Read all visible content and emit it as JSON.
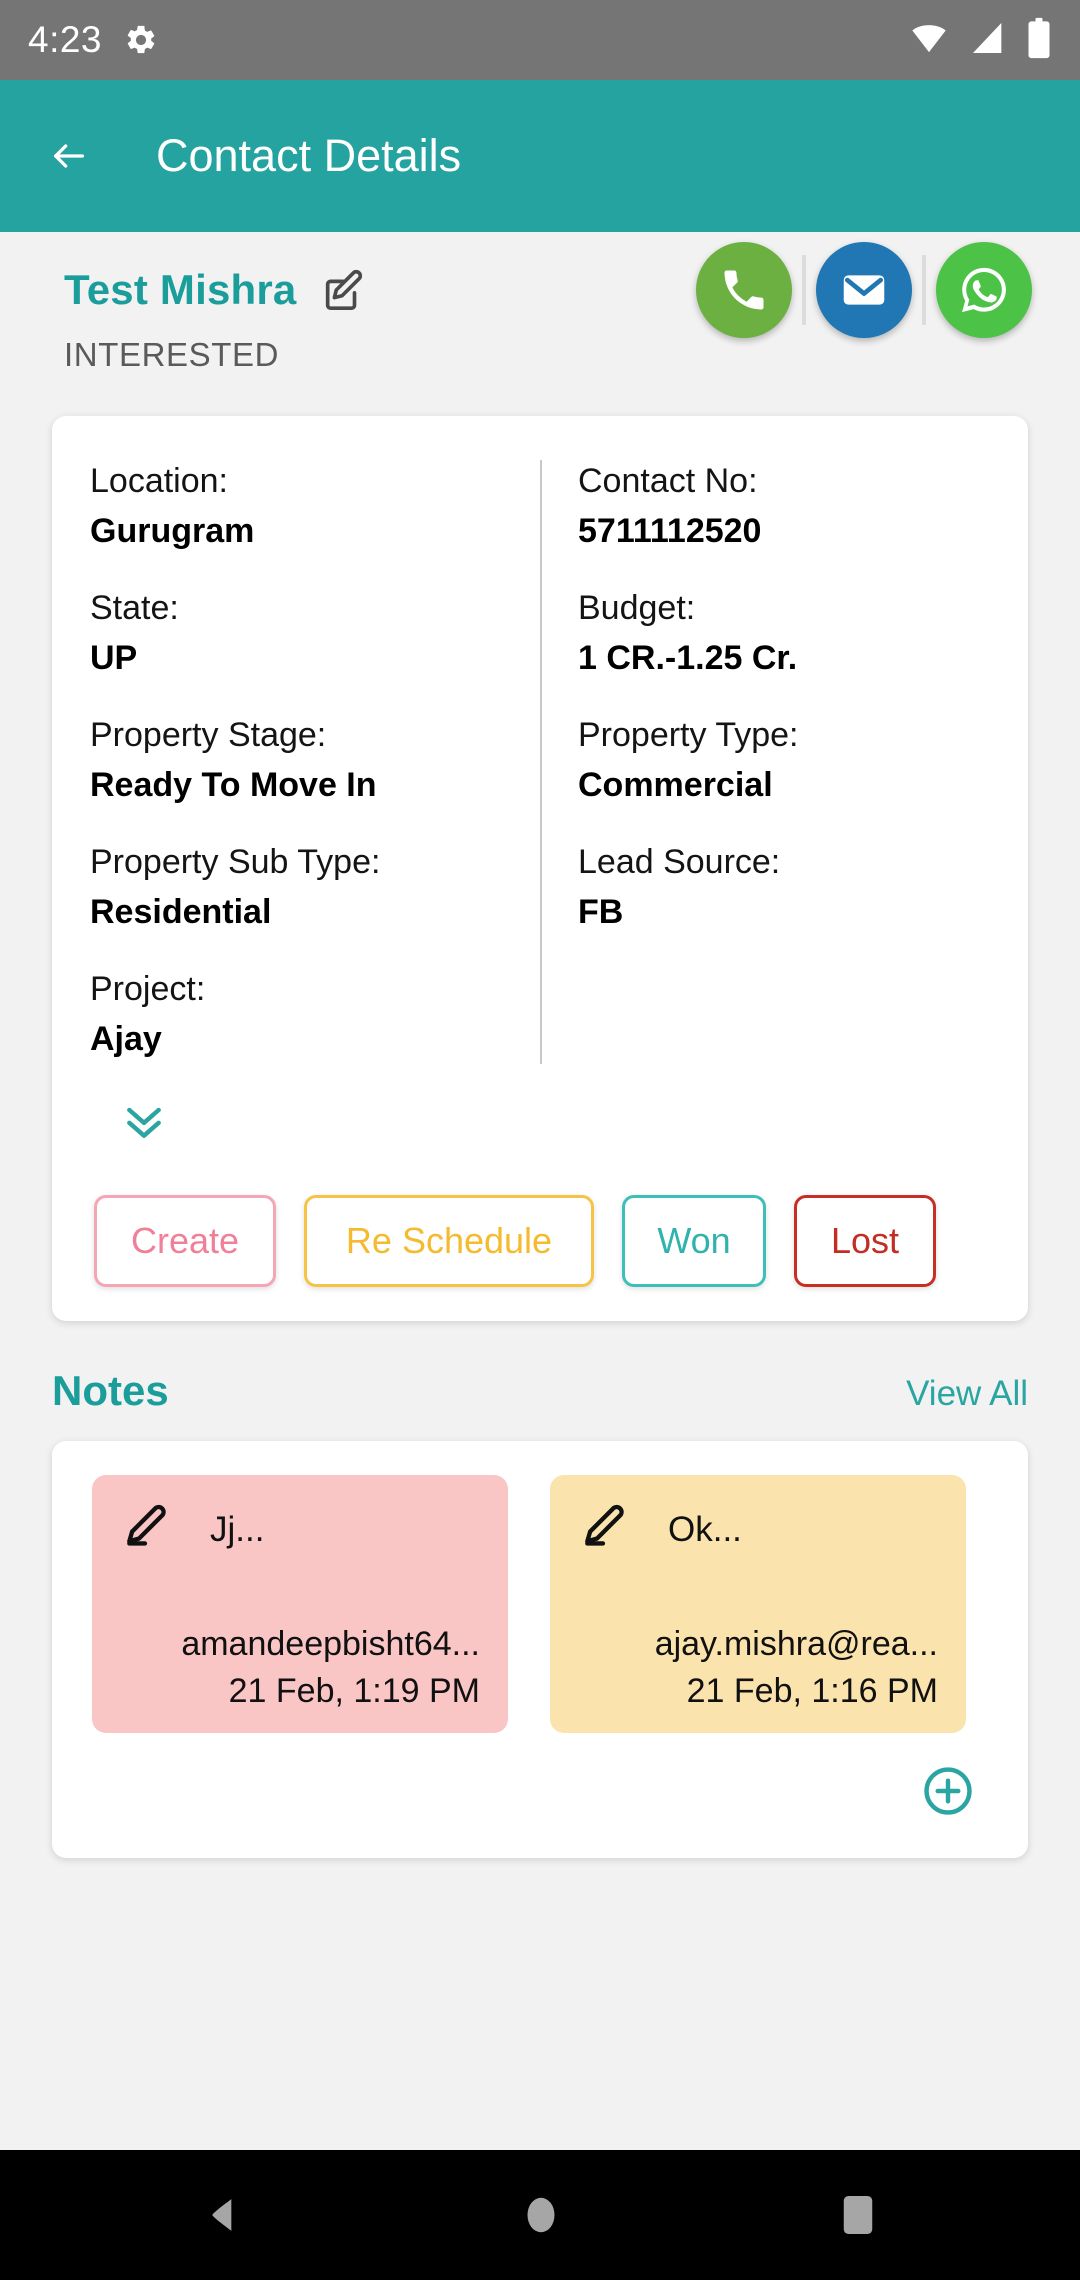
{
  "status_bar": {
    "time": "4:23",
    "icons": [
      "gear-icon",
      "wifi-icon",
      "signal-icon",
      "battery-icon"
    ]
  },
  "app_bar": {
    "back_label": "back-arrow",
    "title": "Contact Details"
  },
  "contact": {
    "name": "Test Mishra",
    "status": "INTERESTED",
    "actions": [
      {
        "name": "call",
        "icon": "phone-icon",
        "color": "#6bb040"
      },
      {
        "name": "email",
        "icon": "email-icon",
        "color": "#2077b4"
      },
      {
        "name": "whatsapp",
        "icon": "whatsapp-icon",
        "color": "#4cc247"
      }
    ]
  },
  "details": {
    "left": [
      {
        "label": "Location:",
        "value": "Gurugram"
      },
      {
        "label": "State:",
        "value": "UP"
      },
      {
        "label": "Property Stage:",
        "value": "Ready To Move In"
      },
      {
        "label": "Property Sub Type:",
        "value": "Residential"
      },
      {
        "label": "Project:",
        "value": "Ajay"
      }
    ],
    "right": [
      {
        "label": "Contact No:",
        "value": "5711112520"
      },
      {
        "label": "Budget:",
        "value": "1 CR.-1.25 Cr."
      },
      {
        "label": "Property Type:",
        "value": "Commercial"
      },
      {
        "label": "Lead Source:",
        "value": "FB"
      }
    ],
    "expand_icon": "chevron-double-down-icon"
  },
  "action_buttons": [
    {
      "label": "Create",
      "color": "#f08098",
      "border": "#f4a6b4"
    },
    {
      "label": "Re Schedule",
      "color": "#f5bb2e",
      "border": "#f6c445"
    },
    {
      "label": "Won",
      "color": "#2fb3ac",
      "border": "#3cbfb8"
    },
    {
      "label": "Lost",
      "color": "#c22e22",
      "border": "#c92e25"
    }
  ],
  "notes": {
    "title": "Notes",
    "view_all": "View All",
    "add_icon": "add-circle-icon",
    "items": [
      {
        "title": "Jj...",
        "body": "amandeepbisht64...",
        "time": "21 Feb, 1:19 PM",
        "color": "#f9c5c5",
        "icon": "pencil-icon"
      },
      {
        "title": "Ok...",
        "body": "ajay.mishra@rea...",
        "time": "21 Feb, 1:16 PM",
        "color": "#fae3ac",
        "icon": "pencil-icon"
      }
    ]
  },
  "nav_bar": {
    "items": [
      "back-triangle-icon",
      "home-circle-icon",
      "recents-square-icon"
    ]
  },
  "theme": {
    "primary": "#25a3a0",
    "accent": "#1b9e9b",
    "background": "#f2f2f2"
  }
}
